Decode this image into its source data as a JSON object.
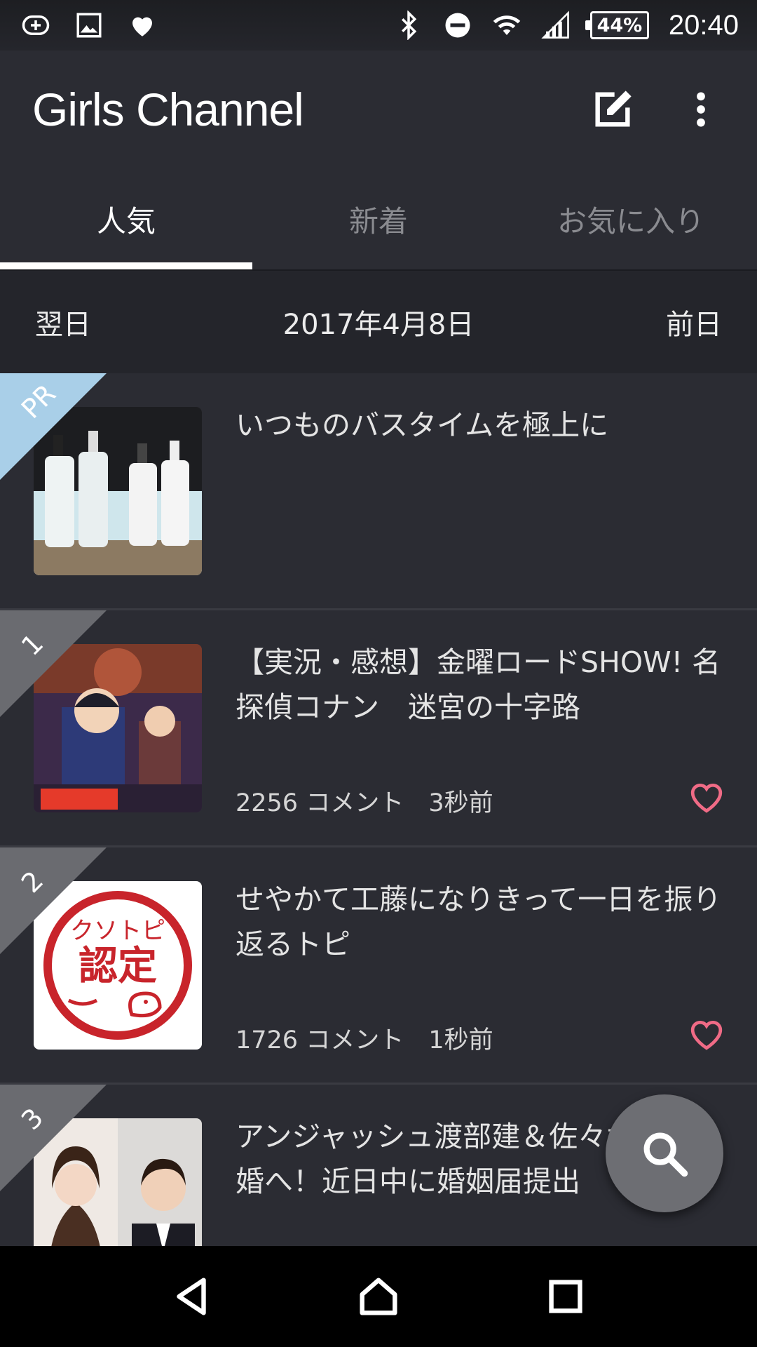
{
  "status_bar": {
    "icons_left": [
      "add-circle-icon",
      "image-icon",
      "heart-icon"
    ],
    "icons_right": [
      "bluetooth-icon",
      "do-not-disturb-icon",
      "wifi-icon",
      "signal-icon"
    ],
    "battery": "44%",
    "time": "20:40"
  },
  "app_bar": {
    "title": "Girls Channel",
    "actions": [
      "edit-icon",
      "more-vert-icon"
    ]
  },
  "tabs": [
    {
      "label": "人気",
      "active": true
    },
    {
      "label": "新着",
      "active": false
    },
    {
      "label": "お気に入り",
      "active": false
    }
  ],
  "date_nav": {
    "next_label": "翌日",
    "current_date": "2017年4月8日",
    "prev_label": "前日"
  },
  "items": [
    {
      "badge": "PR",
      "title": "いつものバスタイムを極上に",
      "comments": "",
      "time": "",
      "thumb": "bottles-image"
    },
    {
      "badge": "1",
      "title": "【実況・感想】金曜ロードSHOW! 名探偵コナン　迷宮の十字路",
      "comments": "2256 コメント",
      "time": "3秒前",
      "thumb": "anime-image"
    },
    {
      "badge": "2",
      "title": "せやかて工藤になりきって一日を振り返るトピ",
      "comments": "1726 コメント",
      "time": "1秒前",
      "thumb": "stamp-image",
      "stamp_text_top": "クソトピ",
      "stamp_text_main": "認定"
    },
    {
      "badge": "3",
      "title": "アンジャッシュ渡部建＆佐々木希 結婚へ！近日中に婚姻届提出",
      "comments": "",
      "time": "",
      "thumb": "portraits-image"
    }
  ],
  "colors": {
    "background": "#2b2c33",
    "pr_ribbon": "#a9cfe8",
    "rank_ribbon": "#6a6b70",
    "heart": "#f06b86"
  },
  "fab": "search-icon",
  "nav_bar": [
    "back-icon",
    "home-icon",
    "recents-icon"
  ]
}
